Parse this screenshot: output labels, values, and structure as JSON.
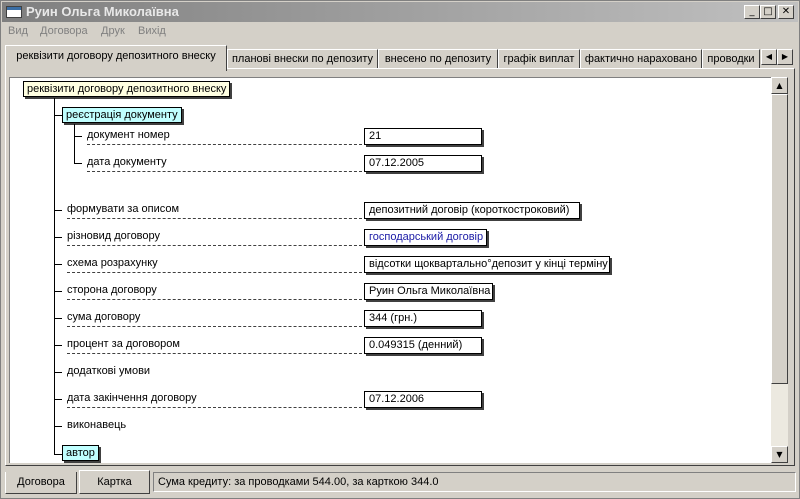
{
  "window": {
    "title": "Руин Ольга Миколаївна",
    "minimize": "_",
    "maximize": "□",
    "close": "✕"
  },
  "menu": [
    "Вид",
    "Договора",
    "Друк",
    "Вихід"
  ],
  "tabs": [
    {
      "label": "реквізити договору депозитного внеску",
      "active": true
    },
    {
      "label": "планові внески по депозиту",
      "active": false
    },
    {
      "label": "внесено по депозиту",
      "active": false
    },
    {
      "label": "графік виплат",
      "active": false
    },
    {
      "label": "фактично нараховано",
      "active": false
    },
    {
      "label": "проводки",
      "active": false
    }
  ],
  "tab_scroll": {
    "left": "◀",
    "right": "▶"
  },
  "tree": {
    "root": "реквізити договору депозитного внеску",
    "group_registration": "реєстрація документу",
    "doc_number_label": "документ номер",
    "doc_number_value": "21",
    "doc_date_label": "дата документу",
    "doc_date_value": "07.12.2005",
    "description_label": "формувати за описом",
    "description_value": "депозитний договір (короткостроковий)",
    "kind_label": "різновид договору",
    "kind_value": "господарський договір",
    "scheme_label": "схема розрахунку",
    "scheme_value": "відсотки щоквартально°депозит у кінці терміну",
    "party_label": "сторона договору",
    "party_value": "Руин Ольга Миколаївна",
    "amount_label": "сума договору",
    "amount_value": "344   (грн.)",
    "percent_label": "процент за договором",
    "percent_value": "0.049315   (денний)",
    "extra_label": "додаткові умови",
    "end_date_label": "дата закінчення договору",
    "end_date_value": "07.12.2006",
    "executor_label": "виконавець",
    "group_author": "автор"
  },
  "scroll": {
    "up": "▲",
    "down": "▼"
  },
  "bottom_tabs": [
    {
      "label": "Договора",
      "active": false
    },
    {
      "label": "Картка",
      "active": true
    }
  ],
  "status": "Сума кредиту: за проводками 544.00, за карткою 344.0"
}
